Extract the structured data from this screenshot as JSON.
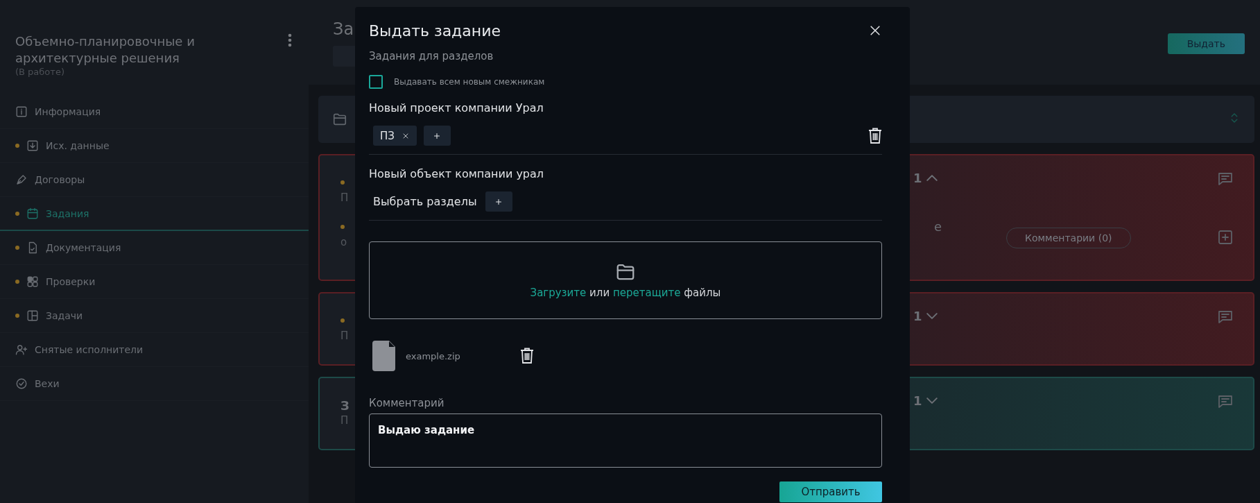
{
  "sidebar": {
    "title": "Объемно-планировочные и архитектурные решения",
    "status": "(В работе)",
    "items": [
      {
        "label": "Информация",
        "dot": false,
        "selected": false
      },
      {
        "label": "Исх. данные",
        "dot": true,
        "selected": false
      },
      {
        "label": "Договоры",
        "dot": false,
        "selected": false
      },
      {
        "label": "Задания",
        "dot": true,
        "selected": true
      },
      {
        "label": "Документация",
        "dot": true,
        "selected": false
      },
      {
        "label": "Проверки",
        "dot": true,
        "selected": false
      },
      {
        "label": "Задачи",
        "dot": true,
        "selected": false
      },
      {
        "label": "Снятые исполнители",
        "dot": false,
        "selected": false
      },
      {
        "label": "Вехи",
        "dot": false,
        "selected": false
      }
    ]
  },
  "header": {
    "title": "За",
    "button": "Выдать"
  },
  "cards": [
    {
      "kind": "folder"
    },
    {
      "kind": "task",
      "color": "#5a1f24",
      "expanded": true,
      "dot": true,
      "title": "П",
      "count": "1",
      "detail": {
        "dot": true,
        "title": "о",
        "side": "е",
        "comments": "Комментарии (0)"
      }
    },
    {
      "kind": "task",
      "color": "#5a1f24",
      "expanded": false,
      "dot": true,
      "title": "П",
      "count": "1"
    },
    {
      "kind": "task",
      "color": "#1d4a48",
      "expanded": false,
      "dot": false,
      "heading": "З",
      "title": "П",
      "count": "1"
    }
  ],
  "modal": {
    "title": "Выдать задание",
    "section_label": "Задания для разделов",
    "checkbox": {
      "label": "Выдавать всем новым смежникам",
      "checked": false
    },
    "groups": [
      {
        "title": "Новый проект компании Урал",
        "tags": [
          {
            "label": "ПЗ"
          }
        ],
        "deletable": true
      },
      {
        "title": "Новый объект компании урал",
        "picker_label": "Выбрать разделы",
        "deletable": false
      }
    ],
    "dropzone": [
      {
        "text": "Загрузите",
        "kind": "link"
      },
      {
        "text": " или ",
        "kind": "plain"
      },
      {
        "text": "перетащите",
        "kind": "link"
      },
      {
        "text": " файлы",
        "kind": "plain"
      }
    ],
    "files": [
      {
        "name": "example.zip"
      }
    ],
    "comment": {
      "label": "Комментарий",
      "value": "Выдаю задание"
    },
    "submit": "Отправить"
  }
}
